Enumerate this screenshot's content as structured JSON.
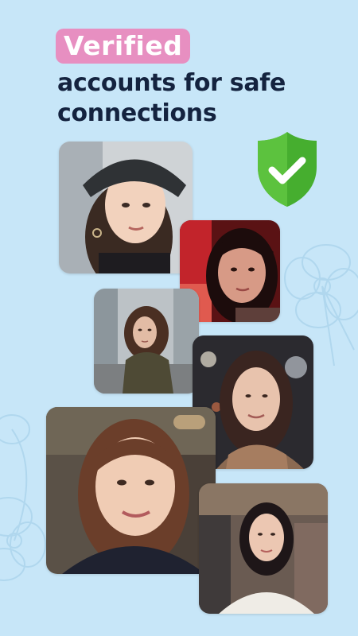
{
  "headline": {
    "badge": "Verified",
    "line1": "accounts for safe",
    "line2": "connections"
  },
  "verified_icon": "shield-check-icon",
  "colors": {
    "background": "#c7e6f8",
    "badge": "#e78fc1",
    "headline_text": "#14233f",
    "shield": "#46ae2f"
  },
  "photos": [
    {
      "name": "profile-photo-woman-black-cap"
    },
    {
      "name": "profile-photo-woman-red-light"
    },
    {
      "name": "profile-photo-woman-street"
    },
    {
      "name": "profile-photo-woman-scarf"
    },
    {
      "name": "profile-photo-woman-smiling-cafe"
    },
    {
      "name": "profile-photo-woman-white-sweater"
    }
  ]
}
